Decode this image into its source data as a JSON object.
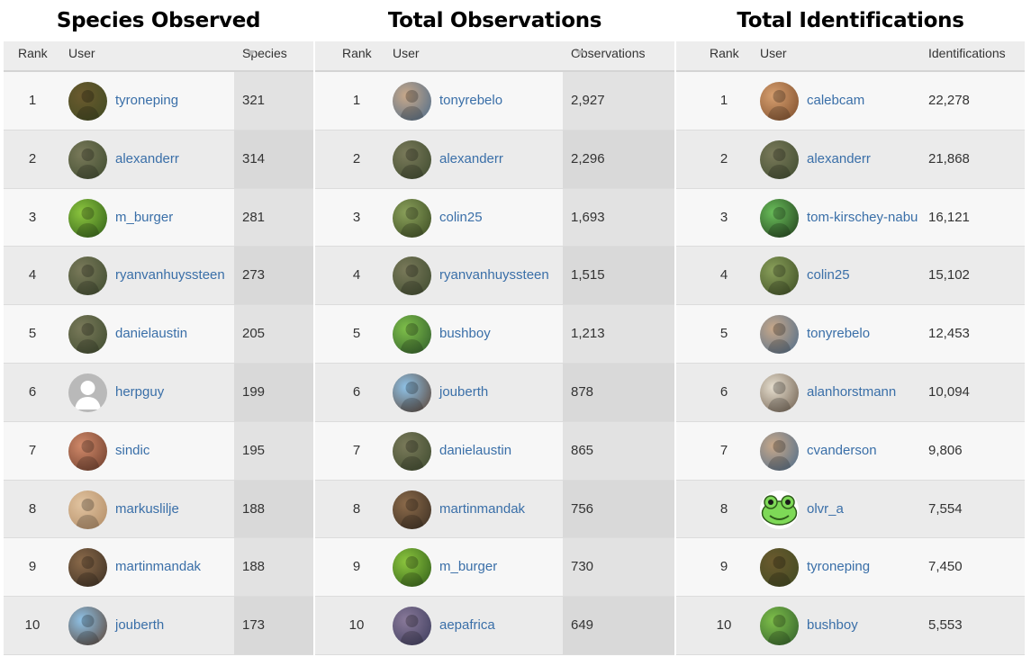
{
  "panels": [
    {
      "title": "Species Observed",
      "col_rank": "Rank",
      "col_user": "User",
      "col_value": "Species",
      "sorted": true,
      "rows": [
        {
          "rank": "1",
          "user": "tyroneping",
          "value": "321",
          "avatar": "nature-photo"
        },
        {
          "rank": "2",
          "user": "alexanderr",
          "value": "314",
          "avatar": "person-photo"
        },
        {
          "rank": "3",
          "user": "m_burger",
          "value": "281",
          "avatar": "green-scales-photo"
        },
        {
          "rank": "4",
          "user": "ryanvanhuyssteen",
          "value": "273",
          "avatar": "person-photo"
        },
        {
          "rank": "5",
          "user": "danielaustin",
          "value": "205",
          "avatar": "person-photo"
        },
        {
          "rank": "6",
          "user": "herpguy",
          "value": "199",
          "avatar": "default-user"
        },
        {
          "rank": "7",
          "user": "sindic",
          "value": "195",
          "avatar": "animal-photo"
        },
        {
          "rank": "8",
          "user": "markuslilje",
          "value": "188",
          "avatar": "sand-photo"
        },
        {
          "rank": "9",
          "user": "martinmandak",
          "value": "188",
          "avatar": "people-photo"
        },
        {
          "rank": "10",
          "user": "jouberth",
          "value": "173",
          "avatar": "sky-person-photo"
        }
      ]
    },
    {
      "title": "Total Observations",
      "col_rank": "Rank",
      "col_user": "User",
      "col_value": "Observations",
      "sorted": true,
      "rows": [
        {
          "rank": "1",
          "user": "tonyrebelo",
          "value": "2,927",
          "avatar": "portrait-photo"
        },
        {
          "rank": "2",
          "user": "alexanderr",
          "value": "2,296",
          "avatar": "person-photo"
        },
        {
          "rank": "3",
          "user": "colin25",
          "value": "1,693",
          "avatar": "lizard-photo"
        },
        {
          "rank": "4",
          "user": "ryanvanhuyssteen",
          "value": "1,515",
          "avatar": "person-photo"
        },
        {
          "rank": "5",
          "user": "bushboy",
          "value": "1,213",
          "avatar": "snake-photo"
        },
        {
          "rank": "6",
          "user": "jouberth",
          "value": "878",
          "avatar": "sky-person-photo"
        },
        {
          "rank": "7",
          "user": "danielaustin",
          "value": "865",
          "avatar": "person-photo"
        },
        {
          "rank": "8",
          "user": "martinmandak",
          "value": "756",
          "avatar": "people-photo"
        },
        {
          "rank": "9",
          "user": "m_burger",
          "value": "730",
          "avatar": "green-scales-photo"
        },
        {
          "rank": "10",
          "user": "aepafrica",
          "value": "649",
          "avatar": "group-photo"
        }
      ]
    },
    {
      "title": "Total Identifications",
      "col_rank": "Rank",
      "col_user": "User",
      "col_value": "Identifications",
      "sorted": false,
      "rows": [
        {
          "rank": "1",
          "user": "calebcam",
          "value": "22,278",
          "avatar": "spider-photo"
        },
        {
          "rank": "2",
          "user": "alexanderr",
          "value": "21,868",
          "avatar": "person-photo"
        },
        {
          "rank": "3",
          "user": "tom-kirschey-nabu",
          "value": "16,121",
          "avatar": "chameleon-photo"
        },
        {
          "rank": "4",
          "user": "colin25",
          "value": "15,102",
          "avatar": "lizard-photo"
        },
        {
          "rank": "5",
          "user": "tonyrebelo",
          "value": "12,453",
          "avatar": "portrait-photo"
        },
        {
          "rank": "6",
          "user": "alanhorstmann",
          "value": "10,094",
          "avatar": "flower-photo"
        },
        {
          "rank": "7",
          "user": "cvanderson",
          "value": "9,806",
          "avatar": "portrait-photo"
        },
        {
          "rank": "8",
          "user": "olvr_a",
          "value": "7,554",
          "avatar": "frog-emoji"
        },
        {
          "rank": "9",
          "user": "tyroneping",
          "value": "7,450",
          "avatar": "nature-photo"
        },
        {
          "rank": "10",
          "user": "bushboy",
          "value": "5,553",
          "avatar": "snake-photo"
        }
      ]
    }
  ],
  "avatar_colors": {
    "nature-photo": [
      "#6b5a2e",
      "#3f4a22"
    ],
    "person-photo": [
      "#7a7a5a",
      "#3d4a2e"
    ],
    "green-scales-photo": [
      "#8cc63e",
      "#2f5c18"
    ],
    "default-user": [
      "#b9b9b9",
      "#b9b9b9"
    ],
    "animal-photo": [
      "#d28a6a",
      "#6a3b2a"
    ],
    "sand-photo": [
      "#e2c4a0",
      "#b08a64"
    ],
    "people-photo": [
      "#8b6a4a",
      "#3a2e22"
    ],
    "sky-person-photo": [
      "#8fc3e8",
      "#5a4030"
    ],
    "portrait-photo": [
      "#c9a98a",
      "#4a6a8a"
    ],
    "lizard-photo": [
      "#8aa05a",
      "#3a4a22"
    ],
    "snake-photo": [
      "#7fc04a",
      "#2e5a2a"
    ],
    "group-photo": [
      "#8a7a9a",
      "#3a3a5a"
    ],
    "spider-photo": [
      "#d8a070",
      "#7a4a28"
    ],
    "chameleon-photo": [
      "#6abf5a",
      "#1f3a1a"
    ],
    "flower-photo": [
      "#e8e0d0",
      "#6a5a4a"
    ],
    "frog-emoji": [
      "#7ed957",
      "#7ed957"
    ]
  }
}
